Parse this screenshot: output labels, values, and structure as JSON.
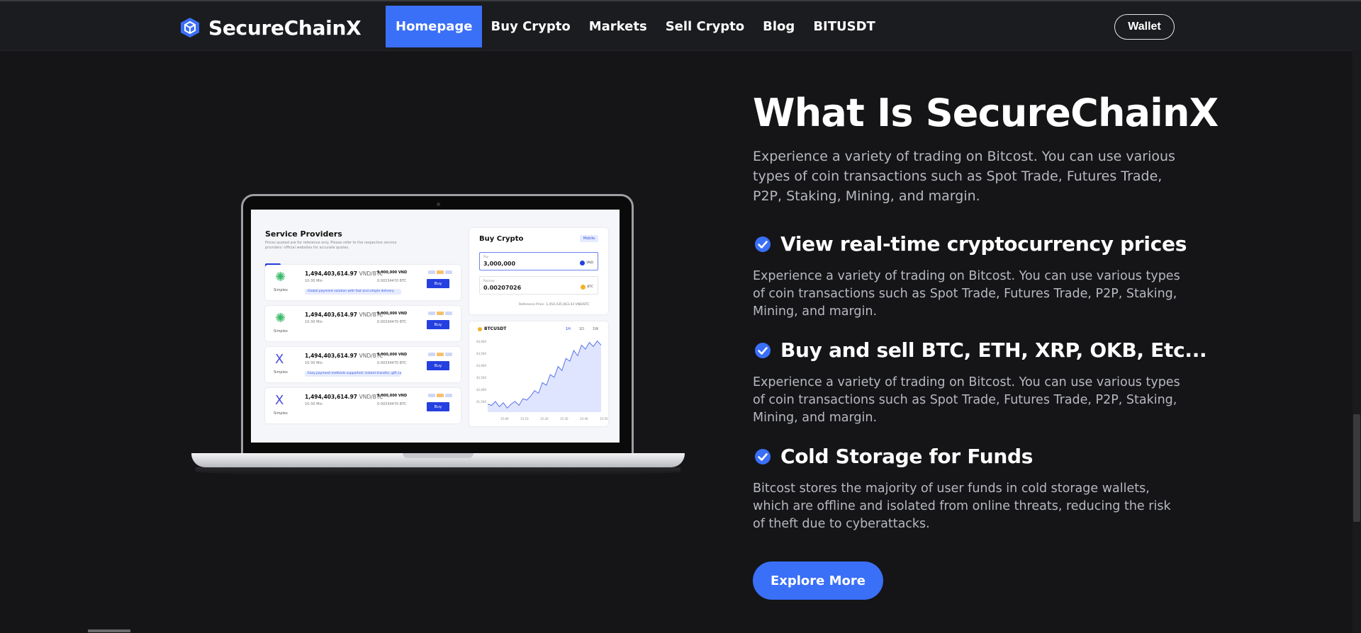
{
  "brand": {
    "name": "SecureChainX",
    "logo_icon": "cube-icon",
    "accent": "#3a6ff8"
  },
  "nav": {
    "items": [
      {
        "label": "Homepage",
        "active": true
      },
      {
        "label": "Buy Crypto",
        "active": false
      },
      {
        "label": "Markets",
        "active": false
      },
      {
        "label": "Sell Crypto",
        "active": false
      },
      {
        "label": "Blog",
        "active": false
      },
      {
        "label": "BITUSDT",
        "active": false
      }
    ],
    "wallet_label": "Wallet"
  },
  "hero": {
    "title": "What Is SecureChainX",
    "intro": "Experience a variety of trading on Bitcost. You can use various types of coin transactions such as Spot Trade, Futures Trade, P2P, Staking, Mining, and margin.",
    "features": [
      {
        "icon": "check-circle-icon",
        "title": "View real-time cryptocurrency prices",
        "desc": "Experience a variety of trading on Bitcost. You can use various types of coin transactions such as Spot Trade, Futures Trade, P2P, Staking, Mining, and margin."
      },
      {
        "icon": "check-circle-icon",
        "title": "Buy and sell BTC, ETH, XRP, OKB, Etc...",
        "desc": "Experience a variety of trading on Bitcost. You can use various types of coin transactions such as Spot Trade, Futures Trade, P2P, Staking, Mining, and margin."
      },
      {
        "icon": "check-circle-icon",
        "title": "Cold Storage for Funds",
        "desc": "Bitcost stores the majority of user funds in cold storage wallets, which are offline and isolated from online threats, reducing the risk of theft due to cyberattacks."
      }
    ],
    "cta_label": "Explore More"
  },
  "mockup": {
    "providers_title": "Service Providers",
    "providers_note": "Prices quoted are for reference only. Please refer to the respective service providers' official websites for accurate quotes.",
    "providers": [
      {
        "name": "Simplex",
        "icon": "✺",
        "icon_color": "#3dbb6b",
        "price": "1,494,403,614.97",
        "unit": "VND/BTC",
        "time": "10-30 Min",
        "limit": "5,000,000 VND",
        "limit_btc": "0.00334470 BTC",
        "buy": "Buy",
        "promo": "Global payment solution with fast and simple delivery"
      },
      {
        "name": "Simplex",
        "icon": "✺",
        "icon_color": "#3dbb6b",
        "price": "1,494,403,614.97",
        "unit": "VND/BTC",
        "time": "10-30 Min",
        "limit": "5,000,000 VND",
        "limit_btc": "0.00334470 BTC",
        "buy": "Buy",
        "promo": ""
      },
      {
        "name": "Simplex",
        "icon": "X",
        "icon_color": "#4a4ee0",
        "price": "1,494,403,614.97",
        "unit": "VND/BTC",
        "time": "10-30 Min",
        "limit": "5,000,000 VND",
        "limit_btc": "0.00334470 BTC",
        "buy": "Buy",
        "promo": "Easy payment methods supported: instant transfer, gift cards"
      },
      {
        "name": "Simplex",
        "icon": "X",
        "icon_color": "#4a4ee0",
        "price": "1,494,403,614.97",
        "unit": "VND/BTC",
        "time": "10-30 Min",
        "limit": "5,000,000 VND",
        "limit_btc": "0.00334470 BTC",
        "buy": "Buy",
        "promo": ""
      }
    ],
    "buy_panel": {
      "title": "Buy Crypto",
      "tag": "Mobile",
      "pay_label": "Pay",
      "pay_value": "3,000,000",
      "pay_currency": "VND",
      "receive_label": "Receive",
      "receive_value": "0.00207026",
      "receive_currency": "BTC",
      "ref": "Reference Price: 1,450,435,063.43 VND/BTC"
    },
    "chart_panel": {
      "symbol": "BTCUSDT",
      "timeframes": [
        "1H",
        "1D",
        "1W"
      ],
      "y_ticks": [
        "44,000",
        "43,500",
        "43,000",
        "42,500",
        "42,000",
        "41,500"
      ],
      "x_ticks": [
        "15:00",
        "15:10",
        "15:20",
        "15:30",
        "15:40",
        "15:50"
      ],
      "values": [
        41600,
        41550,
        41700,
        41500,
        41650,
        41450,
        41600,
        41700,
        41550,
        41800,
        41750,
        41900,
        42100,
        42000,
        42400,
        42300,
        42700,
        42600,
        43000,
        42850,
        43300,
        43200,
        43600,
        43400,
        43800,
        43650,
        43900,
        43750,
        43950,
        43800
      ],
      "ymin": 41300,
      "ymax": 44100
    }
  }
}
